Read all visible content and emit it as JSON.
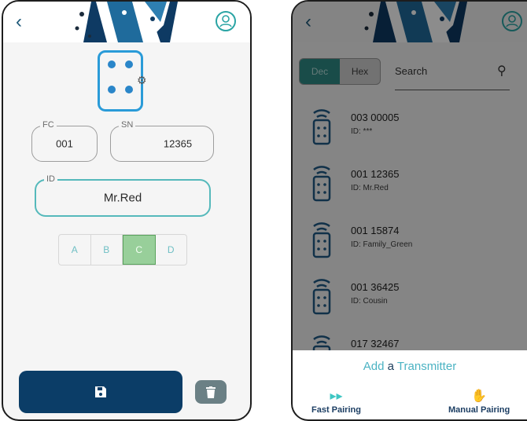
{
  "left_screen": {
    "fc": {
      "label": "FC",
      "value": "001"
    },
    "sn": {
      "label": "SN",
      "value": "12365"
    },
    "id": {
      "label": "ID",
      "value": "Mr.Red"
    },
    "channels": [
      {
        "label": "A",
        "selected": false
      },
      {
        "label": "B",
        "selected": false
      },
      {
        "label": "C",
        "selected": true
      },
      {
        "label": "D",
        "selected": false
      }
    ],
    "save_icon": "floppy-disk-icon",
    "delete_icon": "trash-icon"
  },
  "right_screen": {
    "format_toggle": [
      "Dec",
      "Hex"
    ],
    "format_selected": "Dec",
    "search_placeholder": "Search",
    "transmitters": [
      {
        "code": "003 00005",
        "id": "ID: ***"
      },
      {
        "code": "001 12365",
        "id": "ID: Mr.Red"
      },
      {
        "code": "001 15874",
        "id": "ID: Family_Green"
      },
      {
        "code": "001 36425",
        "id": "ID: Cousin"
      },
      {
        "code": "017 32467",
        "id": ""
      }
    ],
    "add_title_prefix": "Add",
    "add_title_bold": "a",
    "add_title_suffix": "Transmitter",
    "fast_pairing": "Fast Pairing",
    "manual_pairing": "Manual Pairing"
  },
  "colors": {
    "brand_dark": "#0b3d67",
    "accent_teal": "#55b9bb",
    "selected_green": "#98cf9a"
  }
}
